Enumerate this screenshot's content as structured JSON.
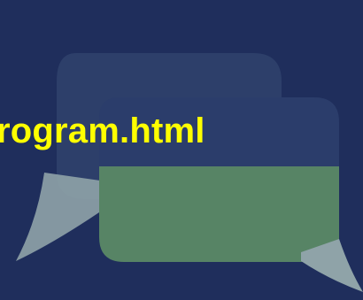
{
  "banner": {
    "filename_text": "rogram.html",
    "icon": "speech-bubbles-icon"
  },
  "colors": {
    "background": "#1f2e5c",
    "back_bubble": "#2d3f6a",
    "back_bubble_tail": "#8fa3a8",
    "front_bubble_green": "#578465",
    "text": "#ffff00"
  }
}
